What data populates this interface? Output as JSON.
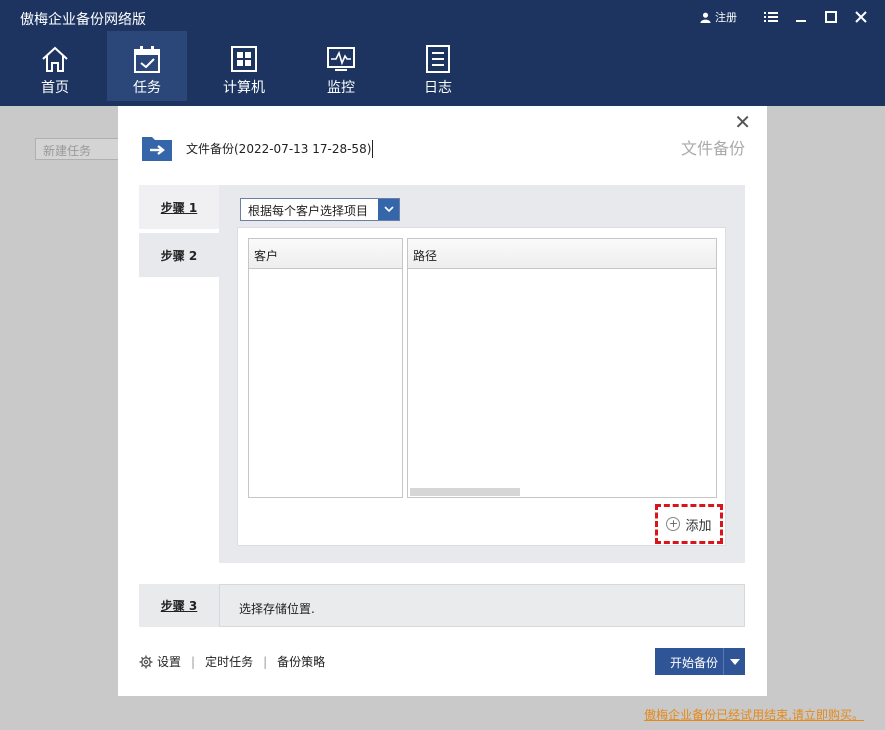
{
  "app": {
    "title": "傲梅企业备份网络版"
  },
  "window": {
    "register_label": "注册"
  },
  "nav": {
    "items": [
      {
        "label": "首页",
        "icon": "home-icon"
      },
      {
        "label": "任务",
        "icon": "task-icon",
        "active": true
      },
      {
        "label": "计算机",
        "icon": "computer-icon"
      },
      {
        "label": "监控",
        "icon": "monitor-icon"
      },
      {
        "label": "日志",
        "icon": "log-icon"
      }
    ]
  },
  "background": {
    "new_task_label": "新建任务"
  },
  "dialog": {
    "type_label": "文件备份",
    "task_name": "文件备份(2022-07-13 17-28-58)",
    "steps": [
      {
        "label": "步骤 1"
      },
      {
        "label": "步骤 2"
      },
      {
        "label": "步骤 3"
      }
    ],
    "select": {
      "value": "根据每个客户选择项目"
    },
    "columns": {
      "client": "客户",
      "path": "路径"
    },
    "add_label": "添加",
    "step3_text": "选择存储位置.",
    "links": {
      "settings": "设置",
      "schedule": "定时任务",
      "strategy": "备份策略"
    },
    "start_label": "开始备份"
  },
  "trial": {
    "text": "傲梅企业备份已经试用结束,请立即购买。"
  },
  "colors": {
    "titlebar": "#1d3461",
    "active_nav": "#2b4678",
    "accent": "#2f5597",
    "warning": "#e5891a",
    "highlight": "#d9141a"
  }
}
